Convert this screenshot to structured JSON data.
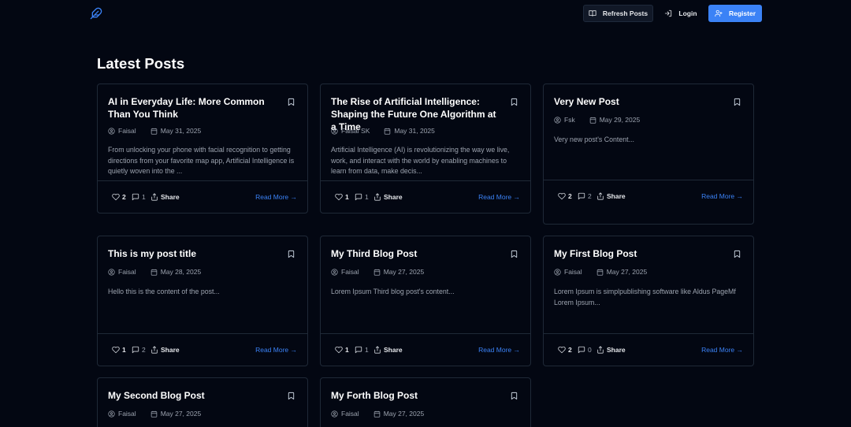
{
  "nav": {
    "refresh_label": "Refresh Posts",
    "login_label": "Login",
    "register_label": "Register"
  },
  "page": {
    "title": "Latest Posts"
  },
  "posts": [
    {
      "title": "AI in Everyday Life: More Common Than You Think",
      "author": "Faisal",
      "date": "May 31, 2025",
      "excerpt": "From unlocking your phone with facial recognition to getting directions from your favorite map app, Artificial Intelligence is quietly woven into the ...",
      "likes": "2",
      "comments": "1",
      "share": "Share",
      "read_more": "Read More →"
    },
    {
      "title": "The Rise of Artificial Intelligence: Shaping the Future One Algorithm at a Time",
      "author": "Faisal SK",
      "date": "May 31, 2025",
      "excerpt": "Artificial Intelligence (AI) is revolutionizing the way we live, work, and interact with the world by enabling machines to learn from data, make decis...",
      "likes": "1",
      "comments": "1",
      "share": "Share",
      "read_more": "Read More →"
    },
    {
      "title": "Very New Post",
      "author": "Fsk",
      "date": "May 29, 2025",
      "excerpt": "Very new post's Content...",
      "likes": "2",
      "comments": "2",
      "share": "Share",
      "read_more": "Read More →"
    },
    {
      "title": "This is my post title",
      "author": "Faisal",
      "date": "May 28, 2025",
      "excerpt": "Hello this is the content of the post...",
      "likes": "1",
      "comments": "2",
      "share": "Share",
      "read_more": "Read More →"
    },
    {
      "title": "My Third Blog Post",
      "author": "Faisal",
      "date": "May 27, 2025",
      "excerpt": "Lorem Ipsum Third blog post's content...",
      "likes": "1",
      "comments": "1",
      "share": "Share",
      "read_more": "Read More →"
    },
    {
      "title": "My First Blog Post",
      "author": "Faisal",
      "date": "May 27, 2025",
      "excerpt": "Lorem Ipsum is simplpublishing software like Aldus PageMf Lorem Ipsum...",
      "likes": "2",
      "comments": "0",
      "share": "Share",
      "read_more": "Read More →"
    },
    {
      "title": "My Second Blog Post",
      "author": "Faisal",
      "date": "May 27, 2025"
    },
    {
      "title": "My Forth Blog Post",
      "author": "Faisal",
      "date": "May 27, 2025"
    }
  ]
}
